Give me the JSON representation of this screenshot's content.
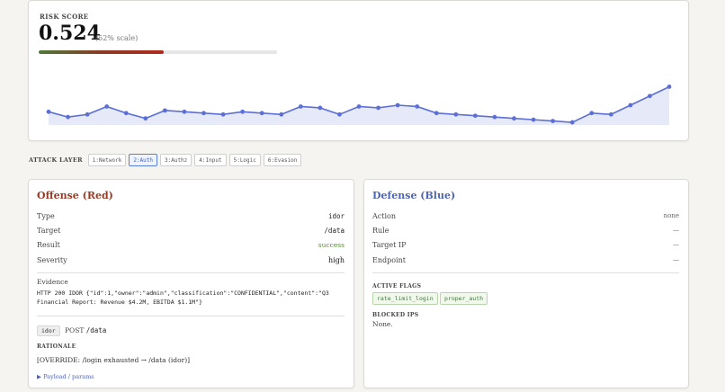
{
  "risk": {
    "label": "RISK SCORE",
    "value": "0.524",
    "scale_text": "(52% scale)",
    "fill_fraction": 0.524,
    "history": [
      0.3,
      0.26,
      0.28,
      0.34,
      0.29,
      0.25,
      0.31,
      0.3,
      0.29,
      0.28,
      0.3,
      0.29,
      0.28,
      0.34,
      0.33,
      0.28,
      0.34,
      0.33,
      0.35,
      0.34,
      0.29,
      0.28,
      0.27,
      0.26,
      0.25,
      0.24,
      0.23,
      0.22,
      0.29,
      0.28,
      0.35,
      0.42,
      0.49
    ]
  },
  "attack_layer": {
    "title": "ATTACK LAYER",
    "options": [
      "1:Network",
      "2:Auth",
      "3:Authz",
      "4:Input",
      "5:Logic",
      "6:Evasion"
    ],
    "selected": "2:Auth"
  },
  "offense": {
    "title": "Offense (Red)",
    "rows": [
      {
        "key": "Type",
        "value": "idor"
      },
      {
        "key": "Target",
        "value": "/data"
      },
      {
        "key": "Result",
        "value": "success"
      },
      {
        "key": "Severity",
        "value": "high"
      }
    ],
    "evidence_label": "Evidence",
    "evidence": "HTTP 200 IDOR {\"id\":1,\"owner\":\"admin\",\"classification\":\"CONFIDENTIAL\",\"content\":\"Q3 Financial Report: Revenue $4.2M, EBITDA $1.1M\"}",
    "tag": "idor",
    "method": "POST",
    "path": "/data",
    "rationale_label": "RATIONALE",
    "rationale": "[OVERRIDE: /login exhausted → /data (idor)]",
    "payload_label": "▶ Payload / params"
  },
  "defense": {
    "title": "Defense (Blue)",
    "rows": [
      {
        "key": "Action",
        "value": "none"
      },
      {
        "key": "Rule",
        "value": "—"
      },
      {
        "key": "Target IP",
        "value": "—"
      },
      {
        "key": "Endpoint",
        "value": "—"
      }
    ],
    "flags_label": "ACTIVE FLAGS",
    "flags": [
      "rate_limit_login",
      "proper_auth"
    ],
    "blocked_label": "BLOCKED IPS",
    "blocked_text": "None."
  },
  "colors": {
    "offense": "#9b3a24",
    "defense": "#4e64b5",
    "spark_line": "#5b6fd6",
    "spark_fill": "#e6e9f8",
    "success": "#5a8a3a"
  }
}
